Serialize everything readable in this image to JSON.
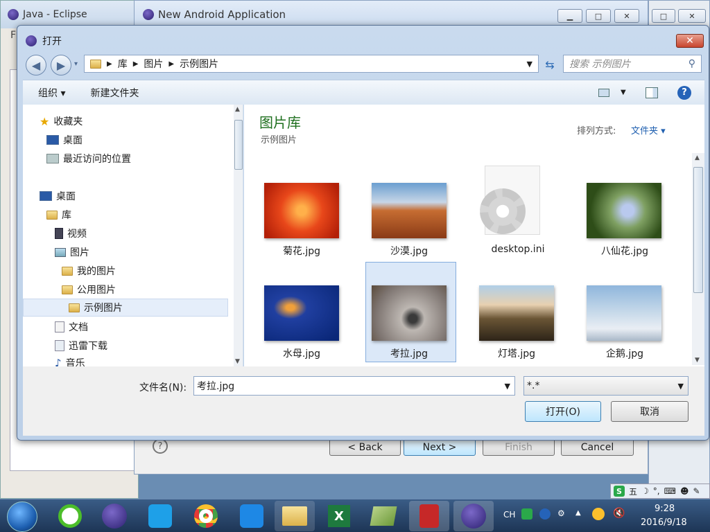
{
  "eclipse": {
    "title": "Java - Eclipse",
    "menu_letter": "F"
  },
  "android": {
    "title": "New Android Application",
    "back": "< Back",
    "next": "Next >",
    "finish": "Finish",
    "cancel": "Cancel",
    "help": "?"
  },
  "dialog": {
    "title": "打开",
    "close": "✕",
    "breadcrumb": [
      "库",
      "图片",
      "示例图片"
    ],
    "search_placeholder": "搜索 示例图片",
    "toolbar": {
      "organize": "组织 ▾",
      "new_folder": "新建文件夹"
    },
    "nav": {
      "favorites": "收藏夹",
      "items": [
        {
          "label": "桌面",
          "level": 1
        },
        {
          "label": "最近访问的位置",
          "level": 1
        },
        {
          "label": "桌面",
          "level": 0
        },
        {
          "label": "库",
          "level": 1
        },
        {
          "label": "视频",
          "level": 2
        },
        {
          "label": "图片",
          "level": 2
        },
        {
          "label": "我的图片",
          "level": 3
        },
        {
          "label": "公用图片",
          "level": 3
        },
        {
          "label": "示例图片",
          "level": 4
        },
        {
          "label": "文档",
          "level": 2
        },
        {
          "label": "迅雷下载",
          "level": 2
        },
        {
          "label": "音乐",
          "level": 2
        }
      ]
    },
    "library_title": "图片库",
    "library_subtitle": "示例图片",
    "arrange_label": "排列方式:",
    "arrange_value": "文件夹 ▾",
    "files": [
      {
        "name": "菊花.jpg",
        "color": "#e04a12"
      },
      {
        "name": "沙漠.jpg",
        "color": "#b5642b"
      },
      {
        "name": "desktop.ini",
        "color": "#e8e8e8"
      },
      {
        "name": "八仙花.jpg",
        "color": "#3c6a22"
      },
      {
        "name": "水母.jpg",
        "color": "#0d3f9a"
      },
      {
        "name": "考拉.jpg",
        "color": "#8c8580"
      },
      {
        "name": "灯塔.jpg",
        "color": "#5a4a35"
      },
      {
        "name": "企鹅.jpg",
        "color": "#9bbbd8"
      }
    ],
    "filename_label": "文件名(N):",
    "filename_value": "考拉.jpg",
    "filter_value": "*.*",
    "open_button": "打开(O)",
    "cancel_button": "取消"
  },
  "taskbar": {
    "lang": "CH",
    "time": "9:28",
    "date": "2016/9/18"
  },
  "ime": {
    "mode": "五"
  }
}
